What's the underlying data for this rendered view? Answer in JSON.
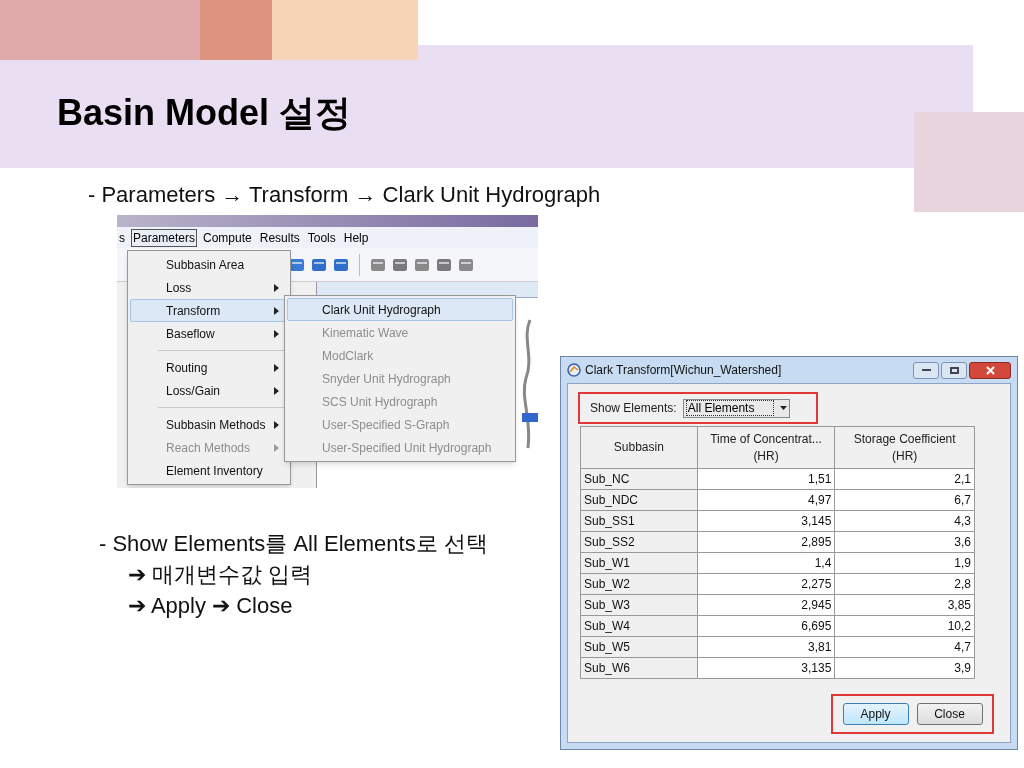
{
  "slide": {
    "title": "Basin Model 설정",
    "bullets": [
      "- Parameters → Transform → Clark Unit Hydrograph",
      "- Show Elements를 All Elements로 선택",
      "➔ 매개변수값 입력",
      "➔ Apply ➔ Close"
    ]
  },
  "menu_screenshot": {
    "menubar": [
      {
        "label": "s",
        "selected": false
      },
      {
        "label": "Parameters",
        "selected": true
      },
      {
        "label": "Compute",
        "selected": false
      },
      {
        "label": "Results",
        "selected": false
      },
      {
        "label": "Tools",
        "selected": false
      },
      {
        "label": "Help",
        "selected": false
      }
    ],
    "menu": [
      {
        "kind": "item",
        "label": "Subbasin Area",
        "submenu": false,
        "disabled": false,
        "selected": false
      },
      {
        "kind": "item",
        "label": "Loss",
        "submenu": true,
        "disabled": false,
        "selected": false
      },
      {
        "kind": "item",
        "label": "Transform",
        "submenu": true,
        "disabled": false,
        "selected": true
      },
      {
        "kind": "item",
        "label": "Baseflow",
        "submenu": true,
        "disabled": false,
        "selected": false
      },
      {
        "kind": "separator"
      },
      {
        "kind": "item",
        "label": "Routing",
        "submenu": true,
        "disabled": false,
        "selected": false
      },
      {
        "kind": "item",
        "label": "Loss/Gain",
        "submenu": true,
        "disabled": false,
        "selected": false
      },
      {
        "kind": "separator"
      },
      {
        "kind": "item",
        "label": "Subbasin Methods",
        "submenu": true,
        "disabled": false,
        "selected": false
      },
      {
        "kind": "item",
        "label": "Reach Methods",
        "submenu": true,
        "disabled": true,
        "selected": false
      },
      {
        "kind": "item",
        "label": "Element Inventory",
        "submenu": false,
        "disabled": false,
        "selected": false
      }
    ],
    "submenu": [
      {
        "label": "Clark Unit Hydrograph",
        "disabled": false,
        "selected": true
      },
      {
        "label": "Kinematic Wave",
        "disabled": true,
        "selected": false
      },
      {
        "label": "ModClark",
        "disabled": true,
        "selected": false
      },
      {
        "label": "Snyder Unit Hydrograph",
        "disabled": true,
        "selected": false
      },
      {
        "label": "SCS Unit Hydrograph",
        "disabled": true,
        "selected": false
      },
      {
        "label": "User-Specified S-Graph",
        "disabled": true,
        "selected": false
      },
      {
        "label": "User-Specified Unit Hydrograph",
        "disabled": true,
        "selected": false
      }
    ]
  },
  "dialog": {
    "title": "Clark Transform[Wichun_Watershed]",
    "show_elements": {
      "label": "Show Elements:",
      "value": "All Elements"
    },
    "table": {
      "columns": [
        {
          "title": "Subbasin"
        },
        {
          "title": "Time of Concentrat...",
          "unit": "(HR)"
        },
        {
          "title": "Storage Coefficient",
          "unit": "(HR)"
        }
      ],
      "rows": [
        [
          "Sub_NC",
          "1,51",
          "2,1"
        ],
        [
          "Sub_NDC",
          "4,97",
          "6,7"
        ],
        [
          "Sub_SS1",
          "3,145",
          "4,3"
        ],
        [
          "Sub_SS2",
          "2,895",
          "3,6"
        ],
        [
          "Sub_W1",
          "1,4",
          "1,9"
        ],
        [
          "Sub_W2",
          "2,275",
          "2,8"
        ],
        [
          "Sub_W3",
          "2,945",
          "3,85"
        ],
        [
          "Sub_W4",
          "6,695",
          "10,2"
        ],
        [
          "Sub_W5",
          "3,81",
          "4,7"
        ],
        [
          "Sub_W6",
          "3,135",
          "3,9"
        ]
      ]
    },
    "buttons": [
      {
        "label": "Apply",
        "kind": "default"
      },
      {
        "label": "Close",
        "kind": "normal"
      }
    ]
  }
}
